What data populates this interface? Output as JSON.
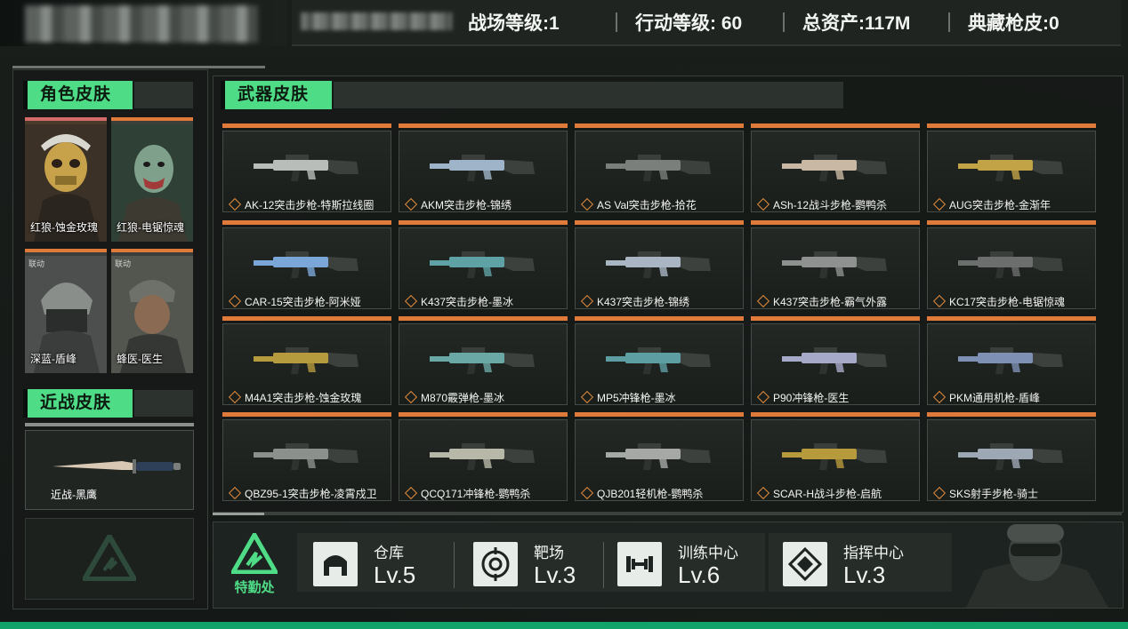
{
  "stats": {
    "battlefield_level": "战场等级:1",
    "action_level": "行动等级: 60",
    "total_assets": "总资产:117M",
    "collection_skins": "典藏枪皮:0"
  },
  "character_section": {
    "title": "角色皮肤",
    "cards": [
      {
        "label": "红狼-蚀金玫瑰",
        "badge": ""
      },
      {
        "label": "红狼-电锯惊魂",
        "badge": ""
      },
      {
        "label": "深蓝-盾峰",
        "badge": "联动"
      },
      {
        "label": "蜂医-医生",
        "badge": "联动"
      }
    ]
  },
  "melee_section": {
    "title": "近战皮肤",
    "item": {
      "label": "近战-黑鹰"
    }
  },
  "weapon_section": {
    "title": "武器皮肤",
    "items": [
      {
        "label": "AK-12突击步枪-特斯拉线圈",
        "tint": "#b9bdba"
      },
      {
        "label": "AKM突击步枪-锦绣",
        "tint": "#9fb4c8"
      },
      {
        "label": "AS Val突击步枪-拾花",
        "tint": "#7b7f7c"
      },
      {
        "label": "ASh-12战斗步枪-鹦鸭杀",
        "tint": "#c9b9a4"
      },
      {
        "label": "AUG突击步枪-金渐年",
        "tint": "#c2a447"
      },
      {
        "label": "CAR-15突击步枪-阿米娅",
        "tint": "#7aa7d8"
      },
      {
        "label": "K437突击步枪-墨冰",
        "tint": "#5fa2a5"
      },
      {
        "label": "K437突击步枪-锦绣",
        "tint": "#a9b5c3"
      },
      {
        "label": "K437突击步枪-霸气外露",
        "tint": "#8e918f"
      },
      {
        "label": "KC17突击步枪-电锯惊魂",
        "tint": "#6c6e6d"
      },
      {
        "label": "M4A1突击步枪-蚀金玫瑰",
        "tint": "#b59a3e"
      },
      {
        "label": "M870霰弹枪-墨冰",
        "tint": "#6aa8a6"
      },
      {
        "label": "MP5冲锋枪-墨冰",
        "tint": "#5c9ea2"
      },
      {
        "label": "P90冲锋枪-医生",
        "tint": "#a7a9c9"
      },
      {
        "label": "PKM通用机枪-盾峰",
        "tint": "#7e90b4"
      },
      {
        "label": "QBZ95-1突击步枪-凌霄戍卫",
        "tint": "#8c908d"
      },
      {
        "label": "QCQ171冲锋枪-鹦鸭杀",
        "tint": "#b8b8a8"
      },
      {
        "label": "QJB201轻机枪-鹦鸭杀",
        "tint": "#a6a8a6"
      },
      {
        "label": "SCAR-H战斗步枪-启航",
        "tint": "#b79a3c"
      },
      {
        "label": "SKS射手步枪-骑士",
        "tint": "#9ea8b5"
      }
    ]
  },
  "bottom_bar": {
    "logo_label": "特勤处",
    "facilities": [
      {
        "name": "仓库",
        "level": "Lv.5",
        "icon": "warehouse-icon"
      },
      {
        "name": "靶场",
        "level": "Lv.3",
        "icon": "target-icon"
      },
      {
        "name": "训练中心",
        "level": "Lv.6",
        "icon": "dumbbell-icon"
      },
      {
        "name": "指挥中心",
        "level": "Lv.3",
        "icon": "command-emblem-icon"
      }
    ]
  },
  "colors": {
    "accent_green": "#4fdc86",
    "accent_orange": "#e07a3a"
  }
}
